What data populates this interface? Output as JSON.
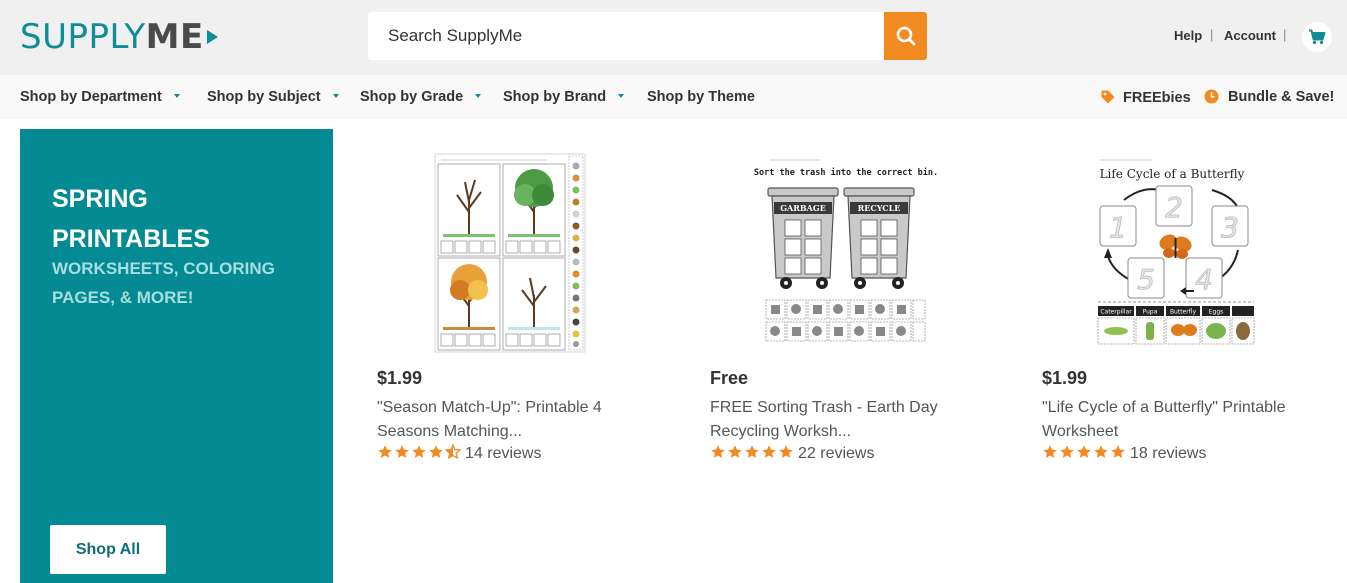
{
  "header": {
    "logo_supply": "SUPPLY",
    "logo_me": "ME",
    "search_placeholder": "Search SupplyMe",
    "help": "Help",
    "account": "Account",
    "separator": "|",
    "accent_color": "#0e8d96",
    "search_button_color": "#f28a22"
  },
  "nav": {
    "items": [
      {
        "label": "Shop by Department",
        "has_dropdown": true
      },
      {
        "label": "Shop by Subject",
        "has_dropdown": true
      },
      {
        "label": "Shop by Grade",
        "has_dropdown": true
      },
      {
        "label": "Shop by Brand",
        "has_dropdown": true
      },
      {
        "label": "Shop by Theme",
        "has_dropdown": false
      }
    ],
    "freebies": "FREEbies",
    "bundle": "Bundle & Save!"
  },
  "promo": {
    "title": "SPRING PRINTABLES",
    "subtitle": "WORKSHEETS, COLORING PAGES, & MORE!",
    "button": "Shop All",
    "bg_color": "#048a92"
  },
  "products": [
    {
      "price": "$1.99",
      "title": "\"Season Match-Up\": Printable 4 Seasons Matching...",
      "rating": 4.5,
      "reviews": "14 reviews",
      "image_name": "season-match-up-worksheet"
    },
    {
      "price": "Free",
      "title": "FREE Sorting Trash - Earth Day Recycling Worksh...",
      "rating": 5,
      "reviews": "22 reviews",
      "image_name": "sorting-trash-worksheet",
      "image_text": {
        "heading": "Sort the trash into the correct bin.",
        "bin_left": "GARBAGE",
        "bin_right": "RECYCLE"
      }
    },
    {
      "price": "$1.99",
      "title": "\"Life Cycle of a Butterfly\" Printable Worksheet",
      "rating": 5,
      "reviews": "18 reviews",
      "image_name": "butterfly-life-cycle-worksheet",
      "image_text": {
        "heading": "Life Cycle of a Butterfly",
        "labels": [
          "Caterpillar",
          "Pupa",
          "Butterfly",
          "Eggs"
        ]
      }
    }
  ],
  "star_color": "#f28a22"
}
